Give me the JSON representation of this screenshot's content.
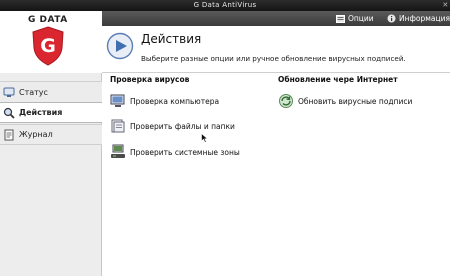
{
  "window": {
    "title": "G Data AntiVirus",
    "close_glyph": "✕"
  },
  "brand": {
    "name": "G DATA",
    "logo_letter": "G",
    "accent": "#d9262f"
  },
  "sidebar": {
    "items": [
      {
        "label": "Статус",
        "icon": "status-icon",
        "active": false
      },
      {
        "label": "Действия",
        "icon": "magnifier-icon",
        "active": true
      },
      {
        "label": "Журнал",
        "icon": "journal-icon",
        "active": false
      }
    ]
  },
  "topbar": {
    "options_label": "Опции",
    "info_label": "Информация"
  },
  "header": {
    "title": "Действия",
    "subtitle": "Выберите разные опции или ручное обновление вирусных подписей."
  },
  "sections": {
    "scan": {
      "title": "Проверка вирусов",
      "actions": [
        {
          "label": "Проверка компьютера",
          "icon": "monitor-icon"
        },
        {
          "label": "Проверить файлы и папки",
          "icon": "folder-icon"
        },
        {
          "label": "Проверить системные зоны",
          "icon": "system-zones-icon"
        }
      ]
    },
    "update": {
      "title": "Обновление чере Интернет",
      "actions": [
        {
          "label": "Обновить вирусные подписи",
          "icon": "update-globe-icon"
        }
      ]
    }
  }
}
